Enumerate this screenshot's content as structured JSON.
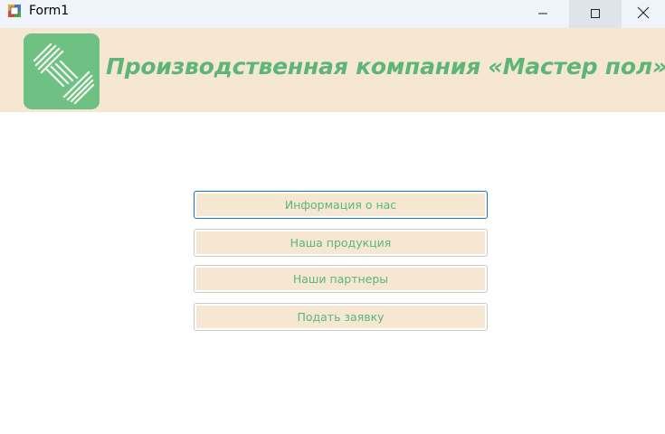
{
  "window": {
    "title": "Form1",
    "icon": "winforms-app-icon",
    "controls": {
      "minimize": "minimize-icon",
      "maximize": "maximize-icon",
      "close": "close-icon"
    }
  },
  "header": {
    "title": "Производственная компания «Мастер пол»",
    "logo": "company-logo-icon",
    "background_color": "#f5e7d2",
    "title_color": "#5db57a",
    "logo_color": "#6fc083"
  },
  "menu": {
    "buttons": [
      {
        "label": "Информация о нас",
        "focused": true
      },
      {
        "label": "Наша продукция"
      },
      {
        "label": "Наши партнеры"
      },
      {
        "label": "Подать заявку"
      }
    ],
    "button_fill": "#f5e7d2",
    "text_color": "#5db57a",
    "focus_border": "#1476c8"
  }
}
